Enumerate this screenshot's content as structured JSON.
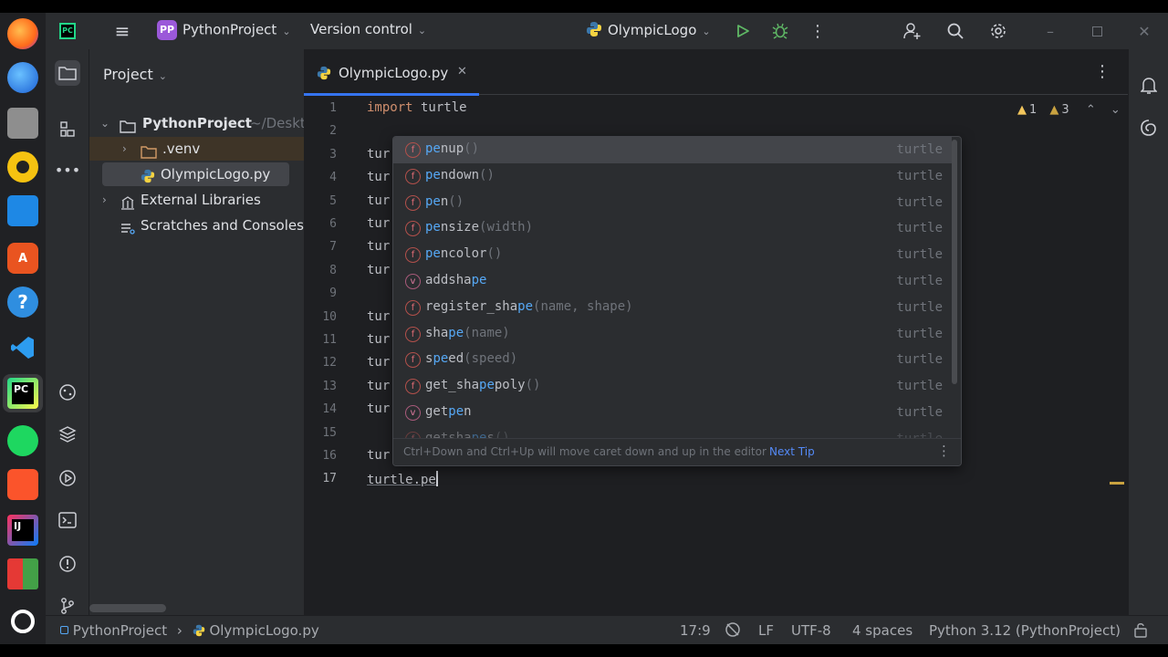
{
  "titlebar": {
    "project_badge": "PP",
    "project_name": "PythonProject",
    "vcs": "Version control",
    "run_config": "OlympicLogo"
  },
  "project_pane": {
    "header": "Project",
    "root_name": "PythonProject",
    "root_path": "~/Deskt",
    "venv": ".venv",
    "file": "OlympicLogo.py",
    "external": "External Libraries",
    "scratches": "Scratches and Consoles"
  },
  "tab": {
    "label": "OlympicLogo.py"
  },
  "inspections": {
    "warn1": "1",
    "warn2": "3"
  },
  "code": {
    "line_numbers": [
      "1",
      "2",
      "3",
      "4",
      "5",
      "6",
      "7",
      "8",
      "9",
      "10",
      "11",
      "12",
      "13",
      "14",
      "15",
      "16",
      "17"
    ],
    "import_kw": "import",
    "import_mod": " turtle",
    "partial": "tur",
    "current_line": "turtle.pe"
  },
  "popup": {
    "items": [
      {
        "pre": "",
        "hl": "pe",
        "post": "nup",
        "sig": "()",
        "type": "turtle",
        "kind": "f"
      },
      {
        "pre": "",
        "hl": "pe",
        "post": "ndown",
        "sig": "()",
        "type": "turtle",
        "kind": "f"
      },
      {
        "pre": "",
        "hl": "pe",
        "post": "n",
        "sig": "()",
        "type": "turtle",
        "kind": "f"
      },
      {
        "pre": "",
        "hl": "pe",
        "post": "nsize",
        "sig": "(width)",
        "type": "turtle",
        "kind": "f"
      },
      {
        "pre": "",
        "hl": "pe",
        "post": "ncolor",
        "sig": "()",
        "type": "turtle",
        "kind": "f"
      },
      {
        "pre": "addsha",
        "hl": "pe",
        "post": "",
        "sig": "",
        "type": "turtle",
        "kind": "v"
      },
      {
        "pre": "register_sha",
        "hl": "pe",
        "post": "",
        "sig": "(name, shape)",
        "type": "turtle",
        "kind": "f"
      },
      {
        "pre": "sha",
        "hl": "pe",
        "post": "",
        "sig": "(name)",
        "type": "turtle",
        "kind": "f"
      },
      {
        "pre": "s",
        "hl": "pe",
        "post": "ed",
        "sig": "(speed)",
        "type": "turtle",
        "kind": "f"
      },
      {
        "pre": "get_sha",
        "hl": "pe",
        "post": "poly",
        "sig": "()",
        "type": "turtle",
        "kind": "f"
      },
      {
        "pre": "get",
        "hl": "pe",
        "post": "n",
        "sig": "",
        "type": "turtle",
        "kind": "v"
      },
      {
        "pre": "getsha",
        "hl": "pe",
        "post": "s",
        "sig": "()",
        "type": "turtle",
        "kind": "f"
      }
    ],
    "hint": "Ctrl+Down and Ctrl+Up will move caret down and up in the editor",
    "next_tip": "Next Tip"
  },
  "statusbar": {
    "crumb_project": "PythonProject",
    "crumb_file": "OlympicLogo.py",
    "position": "17:9",
    "line_sep": "LF",
    "encoding": "UTF-8",
    "indent": "4 spaces",
    "interpreter": "Python 3.12 (PythonProject)"
  },
  "colors": {
    "accent": "#3574f0",
    "background": "#1e1f22",
    "panel": "#2b2d30",
    "keyword": "#cf8e6d",
    "match": "#56a8f5"
  }
}
